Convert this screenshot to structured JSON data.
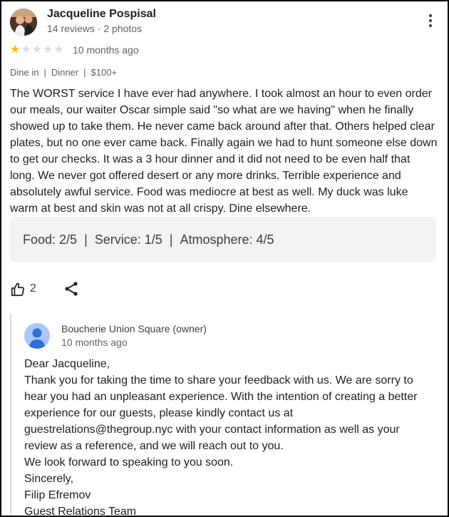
{
  "reviewer": {
    "name": "Jacqueline Pospisal",
    "meta": "14 reviews · 2 photos"
  },
  "rating": {
    "stars": 1,
    "max": 5,
    "time": "10 months ago"
  },
  "tags": [
    "Dine in",
    "Dinner",
    "$100+"
  ],
  "review_text": "The WORST service I have ever had anywhere. I took almost an hour to even order our meals, our waiter Oscar simple said \"so what are we having\" when he finally showed up to take them. He never came back around after that. Others helped clear plates, but no one ever came back. Finally again we had to hunt someone else down to get our checks. It was a 3 hour dinner and it did not need to be even half that long. We never got offered desert or any more drinks. Terrible experience and absolutely awful service. Food was mediocre at best as well. My duck was luke warm at best and skin was not at all crispy. Dine elsewhere.",
  "scores": [
    {
      "label": "Food: 2/5"
    },
    {
      "label": "Service: 1/5"
    },
    {
      "label": "Atmosphere: 4/5"
    }
  ],
  "actions": {
    "like_count": "2"
  },
  "owner_reply": {
    "name": "Boucherie Union Square (owner)",
    "time": "10 months ago",
    "lines": [
      "Dear Jacqueline,",
      "Thank you for taking the time to share your feedback with us. We are sorry to",
      "hear you had an unpleasant experience. With the intention of creating a better",
      "experience for our guests, please kindly contact us at",
      "guestrelations@thegroup.nyc with your contact information as well as your",
      "review as a reference, and we will reach out to you.",
      "We look forward to speaking to you soon.",
      "Sincerely,",
      "Filip Efremov",
      "Guest Relations Team"
    ]
  },
  "colors": {
    "star_on": "#fbbc04",
    "star_off": "#dadce0",
    "scores_bg": "#f1f3f4",
    "owner_avatar": "#a8c7fa"
  },
  "icons": [
    "more-vert-icon",
    "star-icon",
    "thumb-up-icon",
    "share-icon",
    "person-icon"
  ]
}
